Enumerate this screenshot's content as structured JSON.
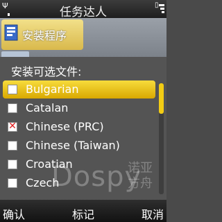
{
  "status_bar": {
    "title": "任务达人",
    "signal_icon": "signal-icon",
    "battery_icon": "battery-icon"
  },
  "background_app": {
    "label": "安装程序",
    "icon": "installer-icon"
  },
  "dialog": {
    "title": "安装可选文件:",
    "items": [
      {
        "label": "Bulgarian",
        "checked": false,
        "selected": true
      },
      {
        "label": "Catalan",
        "checked": false,
        "selected": false
      },
      {
        "label": "Chinese (PRC)",
        "checked": true,
        "selected": false
      },
      {
        "label": "Chinese (Taiwan)",
        "checked": false,
        "selected": false
      },
      {
        "label": "Croatian",
        "checked": false,
        "selected": false
      },
      {
        "label": "Czech",
        "checked": false,
        "selected": false
      }
    ],
    "check_mark": "✕"
  },
  "watermark": {
    "text": "Dospy",
    "text_cn": "诺亚方舟"
  },
  "softkeys": {
    "left": "确认",
    "middle": "标记",
    "right": "取消"
  },
  "colors": {
    "highlight": "#e8c010",
    "dialog_bg": "#545454",
    "check_mark": "#e02020"
  }
}
